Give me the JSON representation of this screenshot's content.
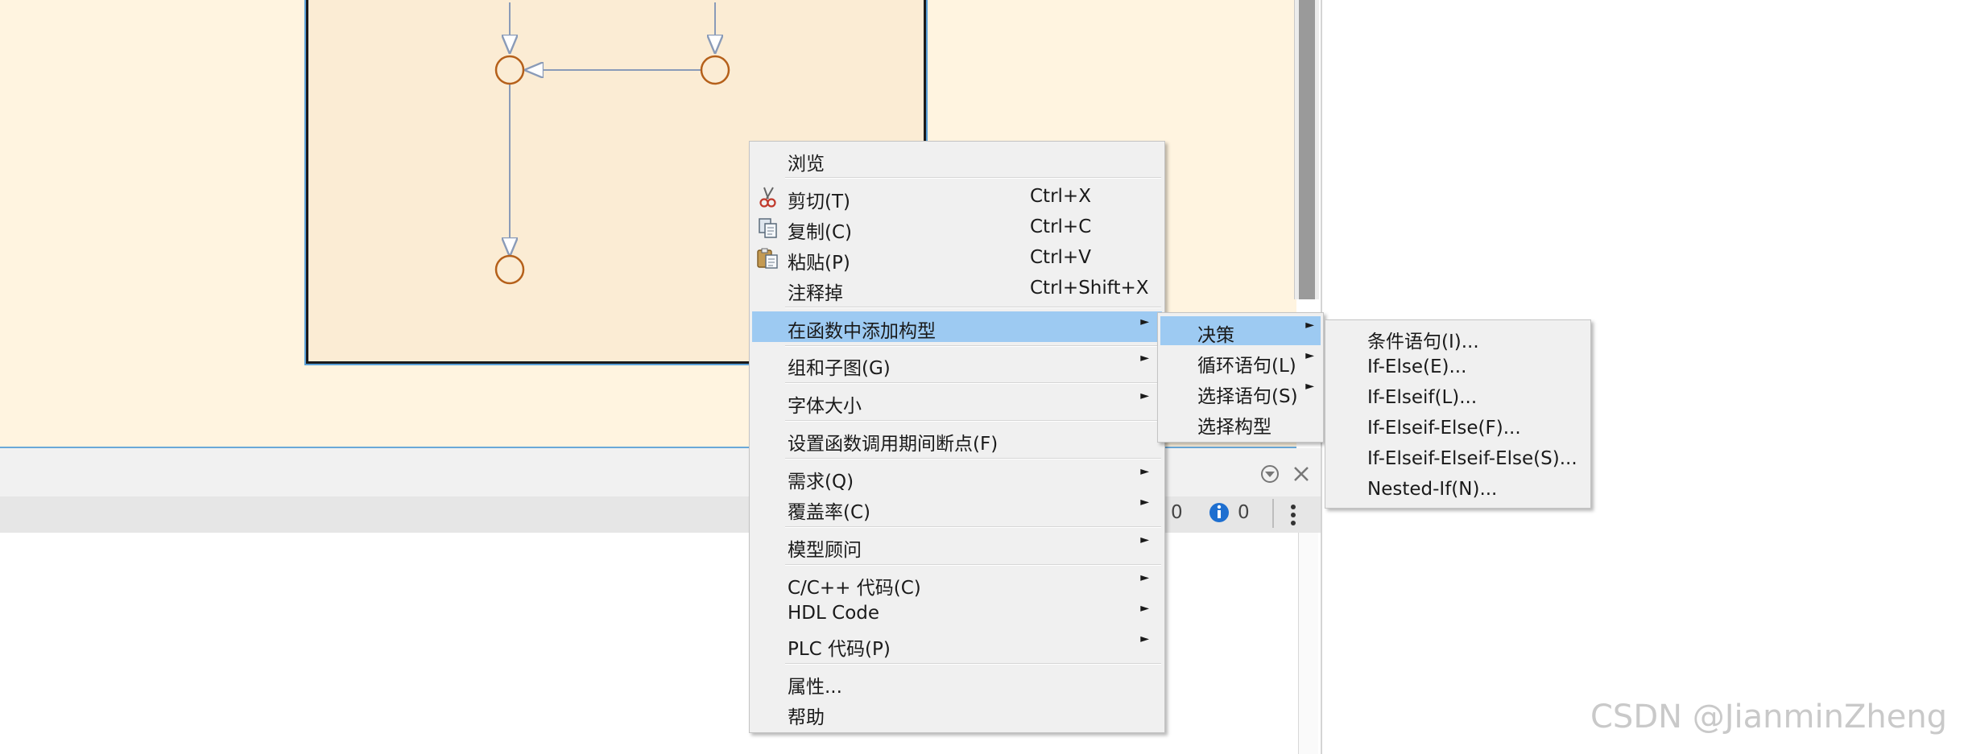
{
  "main_menu": {
    "items": [
      {
        "label": "浏览",
        "shortcut": "",
        "icon": "",
        "submenu": false
      },
      {
        "label": "剪切(T)",
        "shortcut": "Ctrl+X",
        "icon": "scissors-icon",
        "submenu": false
      },
      {
        "label": "复制(C)",
        "shortcut": "Ctrl+C",
        "icon": "copy-icon",
        "submenu": false
      },
      {
        "label": "粘贴(P)",
        "shortcut": "Ctrl+V",
        "icon": "paste-icon",
        "submenu": false
      },
      {
        "label": "注释掉",
        "shortcut": "Ctrl+Shift+X",
        "icon": "",
        "submenu": false
      },
      {
        "label": "在函数中添加构型",
        "shortcut": "",
        "icon": "",
        "submenu": true,
        "highlighted": true
      },
      {
        "label": "组和子图(G)",
        "shortcut": "",
        "icon": "",
        "submenu": true
      },
      {
        "label": "字体大小",
        "shortcut": "",
        "icon": "",
        "submenu": true
      },
      {
        "label": "设置函数调用期间断点(F)",
        "shortcut": "",
        "icon": "",
        "submenu": false
      },
      {
        "label": "需求(Q)",
        "shortcut": "",
        "icon": "",
        "submenu": true
      },
      {
        "label": "覆盖率(C)",
        "shortcut": "",
        "icon": "",
        "submenu": true
      },
      {
        "label": "模型顾问",
        "shortcut": "",
        "icon": "",
        "submenu": true
      },
      {
        "label": "C/C++ 代码(C)",
        "shortcut": "",
        "icon": "",
        "submenu": true
      },
      {
        "label": "HDL Code",
        "shortcut": "",
        "icon": "",
        "submenu": true
      },
      {
        "label": "PLC 代码(P)",
        "shortcut": "",
        "icon": "",
        "submenu": true
      },
      {
        "label": "属性...",
        "shortcut": "",
        "icon": "",
        "submenu": false
      },
      {
        "label": "帮助",
        "shortcut": "",
        "icon": "",
        "submenu": false
      }
    ]
  },
  "submenu_1": {
    "items": [
      {
        "label": "决策",
        "submenu": true,
        "highlighted": true
      },
      {
        "label": "循环语句(L)",
        "submenu": true
      },
      {
        "label": "选择语句(S)",
        "submenu": true
      },
      {
        "label": "选择构型",
        "submenu": false
      }
    ]
  },
  "submenu_2": {
    "items": [
      {
        "label": "条件语句(I)..."
      },
      {
        "label": "If-Else(E)..."
      },
      {
        "label": "If-Elseif(L)..."
      },
      {
        "label": "If-Elseif-Else(F)..."
      },
      {
        "label": "If-Elseif-Elseif-Else(S)..."
      },
      {
        "label": "Nested-If(N)..."
      }
    ]
  },
  "status": {
    "warnings": "0",
    "info": "0"
  },
  "watermark": "CSDN @JianminZheng",
  "colors": {
    "canvas_bg": "#fff4e0",
    "chart_bg": "#fbecd4",
    "junction": "#b5601a",
    "wire": "#8a9bb8",
    "highlight": "#9dcaf2",
    "menu_bg": "#f0f0f0"
  }
}
